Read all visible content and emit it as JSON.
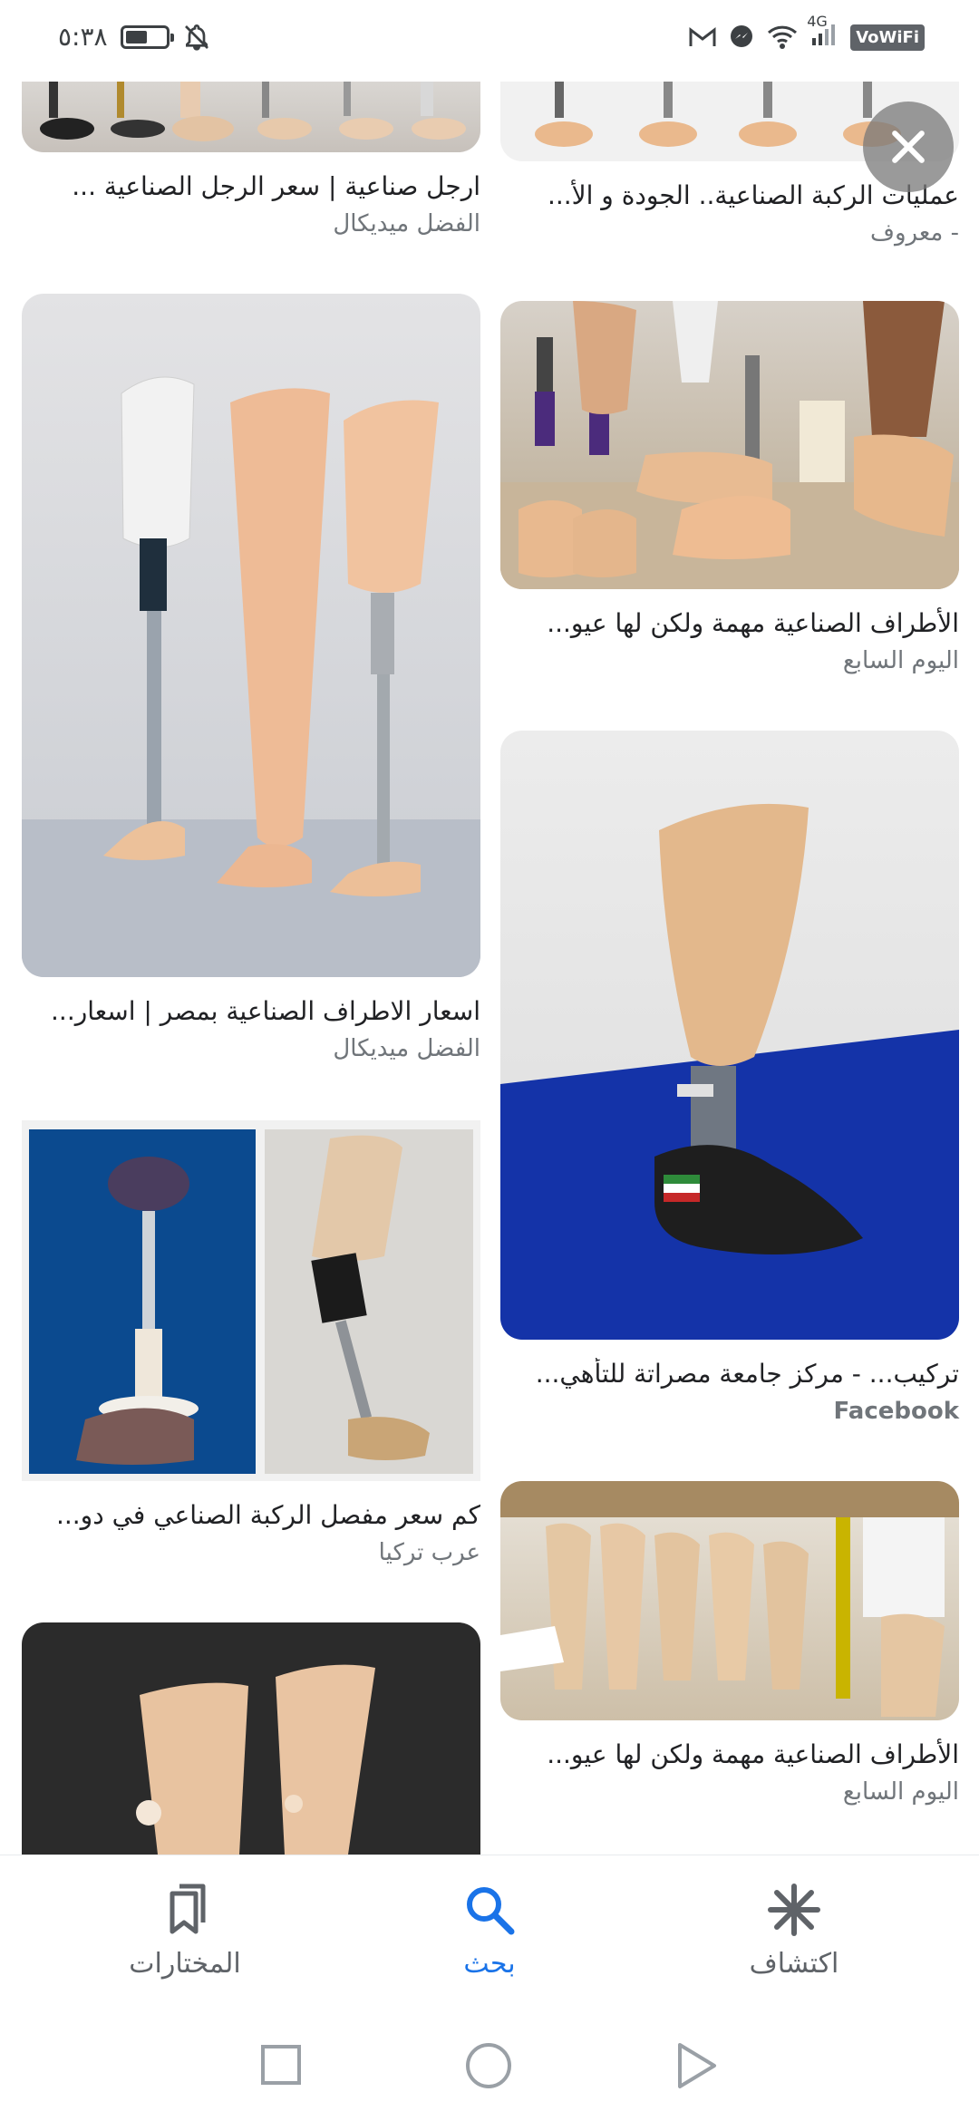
{
  "status_bar": {
    "time": "٥:٣٨",
    "network": "4G",
    "vowifi": "VoWiFi",
    "battery_level": 0.55
  },
  "results": {
    "left_column": [
      {
        "title": "ارجل صناعية | سعر الرجل الصناعية ...",
        "source": "الفضل ميديكال"
      },
      {
        "title": "اسعار الاطراف الصناعية بمصر | اسعار...",
        "source": "الفضل ميديكال"
      },
      {
        "title": "كم سعر مفصل الركبة الصناعي في دو...",
        "source": "عرب تركيا"
      }
    ],
    "right_column": [
      {
        "title": "عمليات الركبة الصناعية.. الجودة و الأ...",
        "source": "- معروف"
      },
      {
        "title": "الأطراف الصناعية مهمة ولكن لها عيو...",
        "source": "اليوم السابع"
      },
      {
        "title": "تركيب... - مركز جامعة مصراتة للتأهي...",
        "source": "Facebook"
      },
      {
        "title": "الأطراف الصناعية مهمة ولكن لها عيو...",
        "source": "اليوم السابع"
      }
    ]
  },
  "bottom_nav": {
    "items": [
      {
        "label": "المختارات",
        "icon": "bookmarks-icon"
      },
      {
        "label": "بحث",
        "icon": "search-icon"
      },
      {
        "label": "اكتشاف",
        "icon": "asterisk-icon"
      }
    ],
    "active_color": "#1a73e8",
    "inactive_color": "#5f6368"
  }
}
